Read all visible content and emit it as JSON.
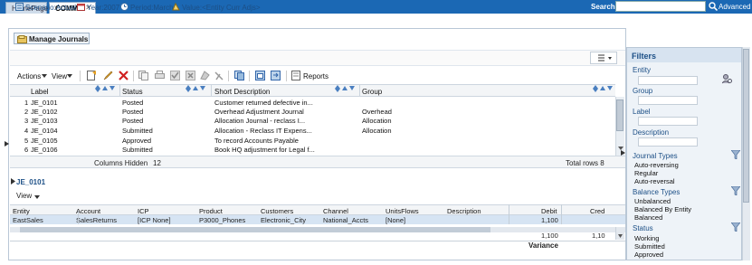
{
  "topbar": {
    "tabs": [
      "HomePage",
      "COMMA"
    ],
    "close": "✕",
    "search_label": "Search:",
    "search_value": "",
    "advanced": "Advanced"
  },
  "page_tab": "Manage Journals",
  "pov": {
    "scenario": "Scenario:Actual",
    "year": "Year:2007",
    "period": "Period:March",
    "value": "Value:<Entity Curr Adjs>"
  },
  "toolbar": {
    "actions": "Actions",
    "view": "View",
    "reports": "Reports"
  },
  "grid": {
    "headers": [
      "Label",
      "Status",
      "Short Description",
      "Group"
    ],
    "rows": [
      {
        "n": "1",
        "label": "JE_0101",
        "status": "Posted",
        "desc": "Customer returned defective in...",
        "group": ""
      },
      {
        "n": "2",
        "label": "JE_0102",
        "status": "Posted",
        "desc": "Overhead Adjustment Journal",
        "group": "Overhead"
      },
      {
        "n": "3",
        "label": "JE_0103",
        "status": "Posted",
        "desc": "Allocation Journal - reclass I...",
        "group": "Allocation"
      },
      {
        "n": "4",
        "label": "JE_0104",
        "status": "Submitted",
        "desc": "Allocation - Reclass IT Expens...",
        "group": "Allocation"
      },
      {
        "n": "5",
        "label": "JE_0105",
        "status": "Approved",
        "desc": "To record Accounts Payable",
        "group": ""
      },
      {
        "n": "6",
        "label": "JE_0106",
        "status": "Submitted",
        "desc": "Book HQ adjustment for Legal f...",
        "group": ""
      }
    ],
    "columns_hidden_label": "Columns Hidden",
    "columns_hidden": "12",
    "total_rows": "Total rows 8"
  },
  "detail": {
    "title": "JE_0101",
    "view": "View",
    "headers": [
      "Entity",
      "Account",
      "ICP",
      "Product",
      "Customers",
      "Channel",
      "UnitsFlows",
      "Description",
      "Debit",
      "Cred"
    ],
    "row": [
      "EastSales",
      "SalesReturns",
      "[ICP None]",
      "P3000_Phones",
      "Electronic_City",
      "National_Accts",
      "[None]",
      "",
      "1,100",
      ""
    ],
    "total_debit": "1,100",
    "total_credit": "1,10",
    "variance": "Variance"
  },
  "filters": {
    "title": "Filters",
    "entity": "Entity",
    "group": "Group",
    "label": "Label",
    "description": "Description",
    "journal_types": "Journal Types",
    "journal_options": [
      "Auto-reversing",
      "Regular",
      "Auto-reversal"
    ],
    "balance_types": "Balance Types",
    "balance_options": [
      "Unbalanced",
      "Balanced By Entity",
      "Balanced"
    ],
    "status": "Status",
    "status_options": [
      "Working",
      "Submitted",
      "Approved"
    ]
  },
  "colors": {
    "topbar": "#1b68b4",
    "accent": "#1c4f86",
    "selection": "#d6e4f3"
  }
}
